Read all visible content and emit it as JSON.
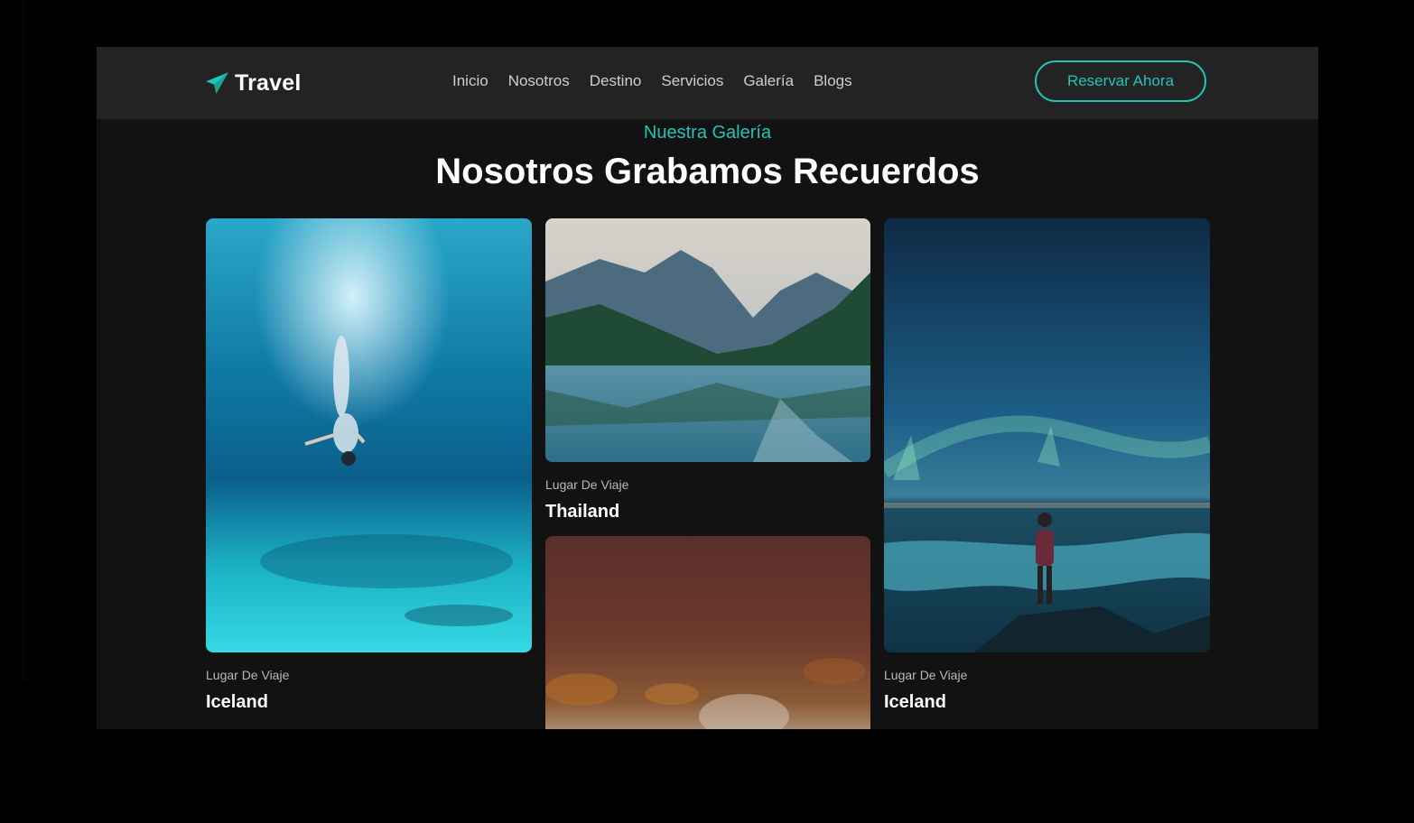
{
  "brand": {
    "name": "Travel",
    "icon": "paper-plane-icon",
    "accent": "#22c4b6"
  },
  "nav": {
    "items": [
      "Inicio",
      "Nosotros",
      "Destino",
      "Servicios",
      "Galería",
      "Blogs"
    ]
  },
  "cta": {
    "label": "Reservar Ahora"
  },
  "gallery": {
    "eyebrow": "Nuestra Galería",
    "title": "Nosotros Grabamos Recuerdos",
    "cards": [
      {
        "image": "underwater-diver-photo",
        "label": "Lugar De Viaje",
        "place": "Iceland"
      },
      {
        "image": "mountain-lake-photo",
        "label": "Lugar De Viaje",
        "place": "Thailand"
      },
      {
        "image": "autumn-forest-photo",
        "label": "",
        "place": ""
      },
      {
        "image": "aurora-night-photo",
        "label": "Lugar De Viaje",
        "place": "Iceland"
      }
    ]
  }
}
